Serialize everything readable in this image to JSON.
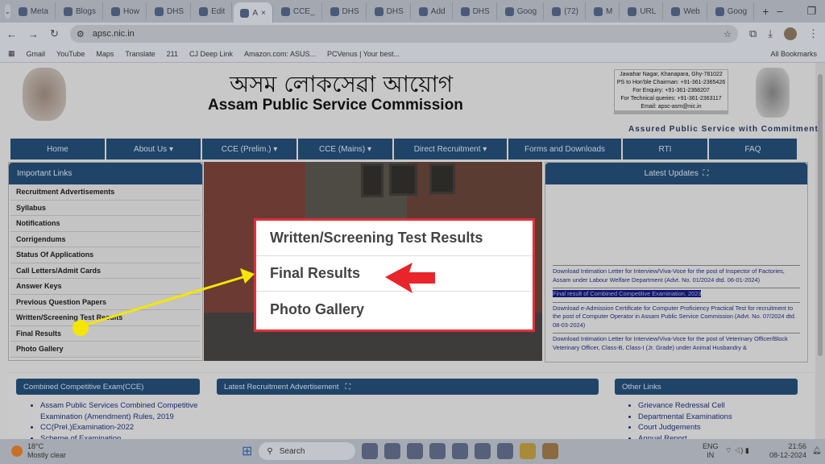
{
  "browser": {
    "tabs": [
      {
        "label": "Meta"
      },
      {
        "label": "Blogs"
      },
      {
        "label": "How"
      },
      {
        "label": "DHS"
      },
      {
        "label": "Edit"
      },
      {
        "label": "A",
        "active": true
      },
      {
        "label": "CCE_"
      },
      {
        "label": "DHS"
      },
      {
        "label": "DHS"
      },
      {
        "label": "Add"
      },
      {
        "label": "DHS"
      },
      {
        "label": "Goog"
      },
      {
        "label": "(72)"
      },
      {
        "label": "M"
      },
      {
        "label": "URL"
      },
      {
        "label": "Web"
      },
      {
        "label": "Goog"
      }
    ],
    "url": "apsc.nic.in",
    "bookmarks": [
      "Gmail",
      "YouTube",
      "Maps",
      "Translate",
      "211",
      "CJ Deep Link",
      "Amazon.com: ASUS...",
      "PCVenus | Your best..."
    ],
    "all_bookmarks": "All Bookmarks"
  },
  "header": {
    "title_assamese": "অসম লোকসেৱা আয়োগ",
    "title": "Assam Public Service Commission",
    "contact": [
      "Jawahar Nagar, Khanapara, Ghy-781022",
      "PS to Hon'ble Chairman: +91-361-2365426",
      "For Enquiry: +91-361-2368207",
      "For Technical queries: +91-361-2363117",
      "Email: apsc-asm@nic.in"
    ],
    "tagline": "Assured Public Service with Commitment"
  },
  "nav": [
    "Home",
    "About Us ▾",
    "CCE (Prelim.) ▾",
    "CCE (Mains) ▾",
    "Direct Recruitment ▾",
    "Forms and Downloads",
    "RTI",
    "FAQ"
  ],
  "important_links": {
    "title": "Important Links",
    "items": [
      "Recruitment Advertisements",
      "Syllabus",
      "Notifications",
      "Corrigendums",
      "Status Of Applications",
      "Call Letters/Admit Cards",
      "Answer Keys",
      "Previous Question Papers",
      "Written/Screening Test Results",
      "Final Results",
      "Photo Gallery"
    ]
  },
  "latest_updates": {
    "title": "Latest Updates",
    "items": [
      "Download Intimation Letter for Interview/Viva-Voce for the post of Inspector of Factories, Assam under Labour Welfare Department (Advt. No. 01/2024 dtd. 06-01-2024)",
      "Final result of Combined Competitive Examination, 2023",
      "Download e-Admission Certificate for Computer Proficiency Practical Test for recruitment to the post of Computer Operator in Assam Public Service Commission (Advt. No. 07/2024 dtd. 08-03-2024)",
      "Download Intimation Letter for Interview/Viva-Voce for the post of Veterinary Officer/Block Veterinary Officer, Class-B, Class-I (Jr. Grade) under Animal Husbandry &"
    ]
  },
  "zoom_callout": [
    "Written/Screening Test Results",
    "Final Results",
    "Photo Gallery"
  ],
  "bottom": {
    "cce_title": "Combined Competitive Exam(CCE)",
    "cce_items": [
      "Assam Public Services Combined Competitive Examination (Amendment) Rules, 2019",
      "CC(Prel.)Examination-2022",
      "Scheme of Examination"
    ],
    "recruit_title": "Latest Recruitment Advertisement",
    "other_title": "Other Links",
    "other_items": [
      "Grievance Redressal Cell",
      "Departmental Examinations",
      "Court Judgements",
      "Annual Report"
    ]
  },
  "taskbar": {
    "temp": "18°C",
    "weather": "Mostly clear",
    "search": "Search",
    "lang": "ENG",
    "region": "IN",
    "time": "21:56",
    "date": "08-12-2024"
  },
  "colors": {
    "nav": "#1f4468",
    "callout_border": "#e0303a",
    "arrow_yellow": "#f5e600",
    "arrow_red": "#e8252b"
  }
}
